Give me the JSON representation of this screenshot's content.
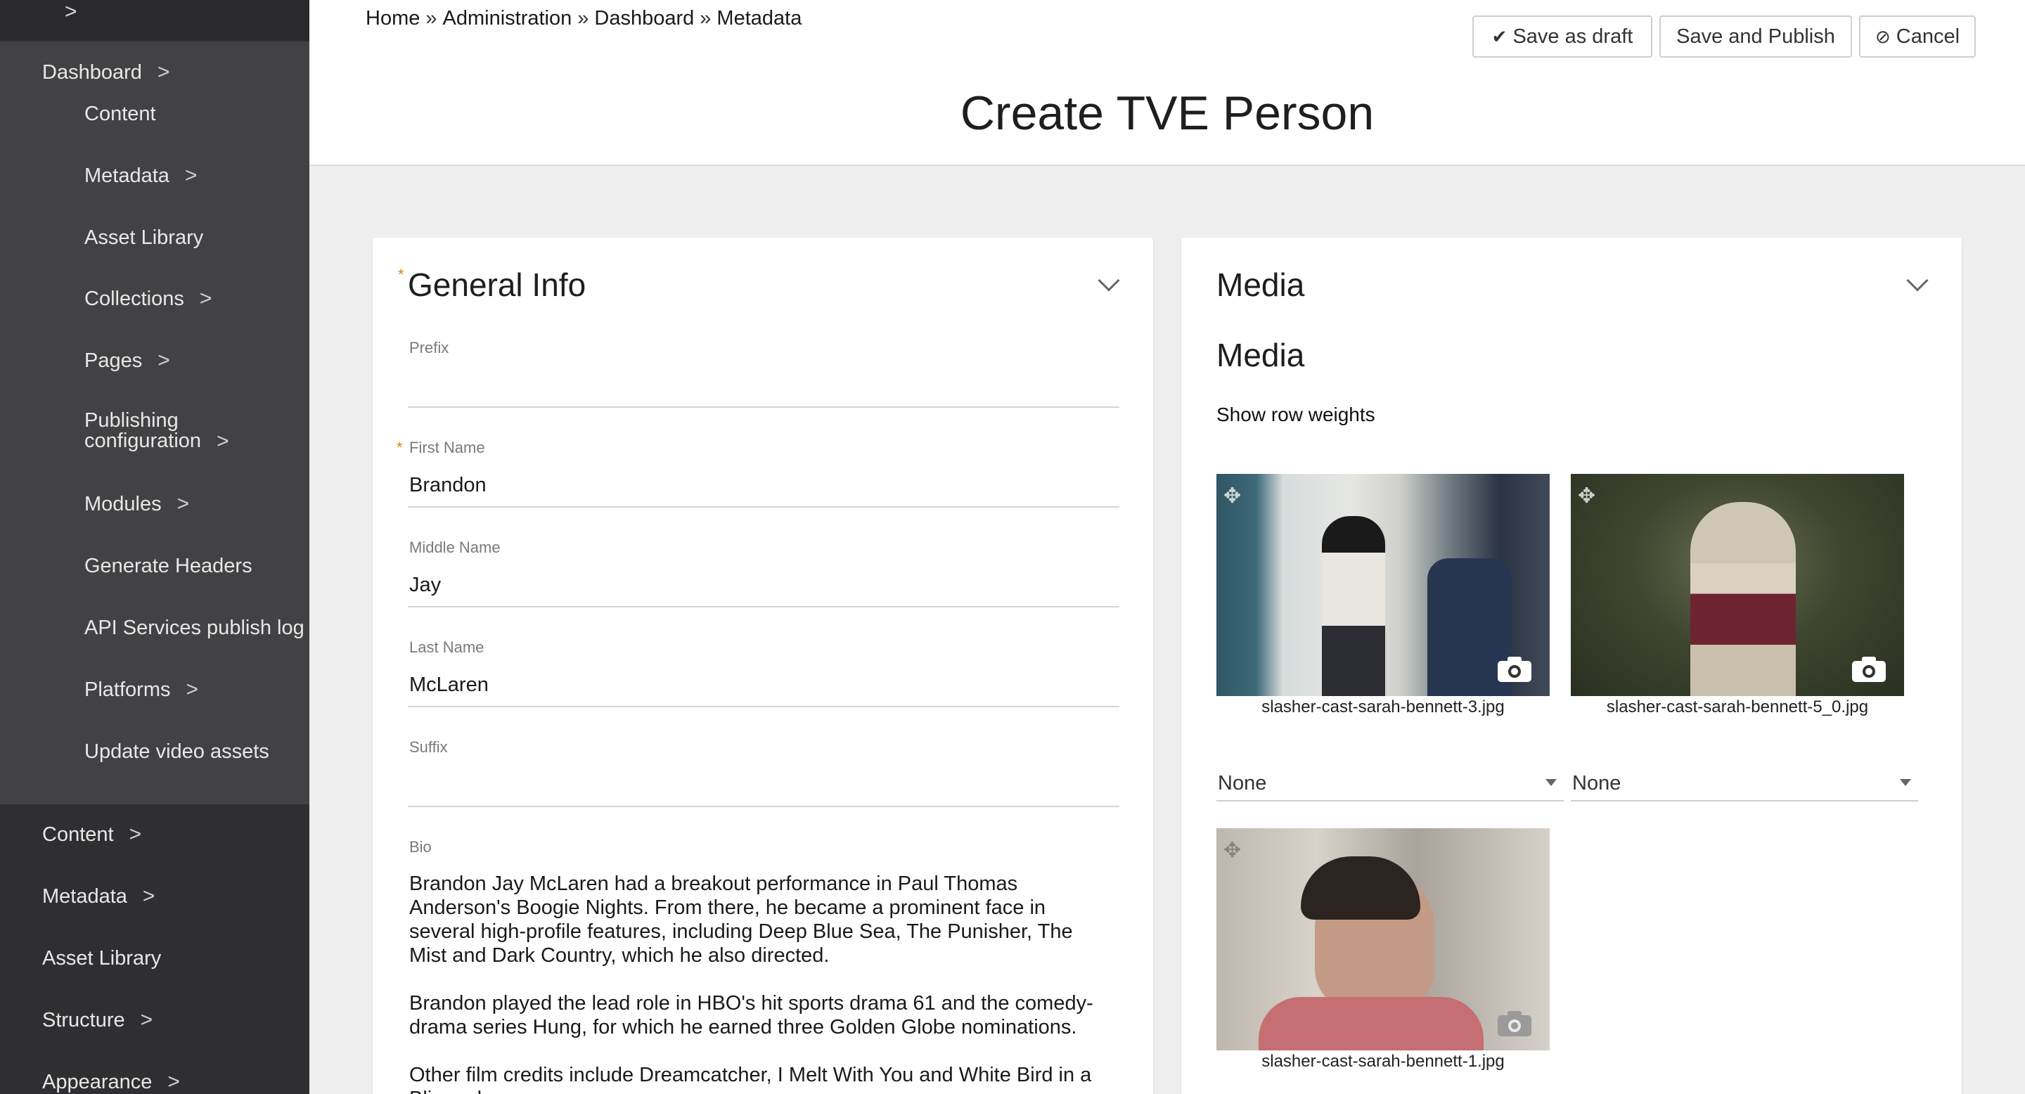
{
  "sidebar": {
    "top_chevron": ">",
    "dashboard": "Dashboard",
    "sub_items": [
      {
        "label": "Content",
        "has_arrow": false
      },
      {
        "label": "Metadata",
        "has_arrow": true
      },
      {
        "label": "Asset Library",
        "has_arrow": false
      },
      {
        "label": "Collections",
        "has_arrow": true
      },
      {
        "label": "Pages",
        "has_arrow": true
      },
      {
        "label": "Publishing configuration",
        "has_arrow": true
      },
      {
        "label": "Modules",
        "has_arrow": true
      },
      {
        "label": "Generate Headers",
        "has_arrow": false
      },
      {
        "label": "API Services publish log",
        "has_arrow": false
      },
      {
        "label": "Platforms",
        "has_arrow": true
      },
      {
        "label": "Update video assets",
        "has_arrow": false
      }
    ],
    "publishing_line1": "Publishing",
    "publishing_line2": "configuration",
    "main_items": [
      {
        "label": "Content"
      },
      {
        "label": "Metadata"
      },
      {
        "label": "Asset Library"
      },
      {
        "label": "Structure"
      },
      {
        "label": "Appearance"
      }
    ],
    "arrow": ">"
  },
  "header": {
    "breadcrumb": [
      "Home",
      "Administration",
      "Dashboard",
      "Metadata"
    ],
    "breadcrumb_sep": "»",
    "title": "Create TVE Person",
    "buttons": {
      "save_draft": "Save as draft",
      "save_publish": "Save and Publish",
      "cancel": "Cancel"
    }
  },
  "general_info": {
    "title": "General Info",
    "required_mark": "*",
    "fields": {
      "prefix": {
        "label": "Prefix",
        "value": ""
      },
      "first_name": {
        "label": "First Name",
        "value": "Brandon"
      },
      "middle_name": {
        "label": "Middle Name",
        "value": "Jay"
      },
      "last_name": {
        "label": "Last Name",
        "value": "McLaren"
      },
      "suffix": {
        "label": "Suffix",
        "value": ""
      },
      "bio": {
        "label": "Bio",
        "paragraphs": [
          "Brandon Jay McLaren had a breakout performance in Paul Thomas Anderson's Boogie Nights. From there, he became a prominent face in several high-profile features, including Deep Blue Sea, The Punisher, The Mist and Dark Country, which he also directed.",
          "Brandon played the lead role in HBO's hit sports drama 61 and the comedy-drama series Hung, for which he earned three Golden Globe nominations.",
          "Other film credits include Dreamcatcher, I Melt With You and White Bird in a Blizzard."
        ]
      }
    }
  },
  "media": {
    "title": "Media",
    "subtitle": "Media",
    "row_weights_link": "Show row weights",
    "items": [
      {
        "caption": "slasher-cast-sarah-bennett-3.jpg",
        "weight": "None"
      },
      {
        "caption": "slasher-cast-sarah-bennett-5_0.jpg",
        "weight": "None"
      },
      {
        "caption": "slasher-cast-sarah-bennett-1.jpg"
      }
    ]
  },
  "colors": {
    "sidebar_dark": "#2f2f31",
    "sidebar_sub": "#424244",
    "required": "#d08a00",
    "page_bg": "#efefef"
  }
}
